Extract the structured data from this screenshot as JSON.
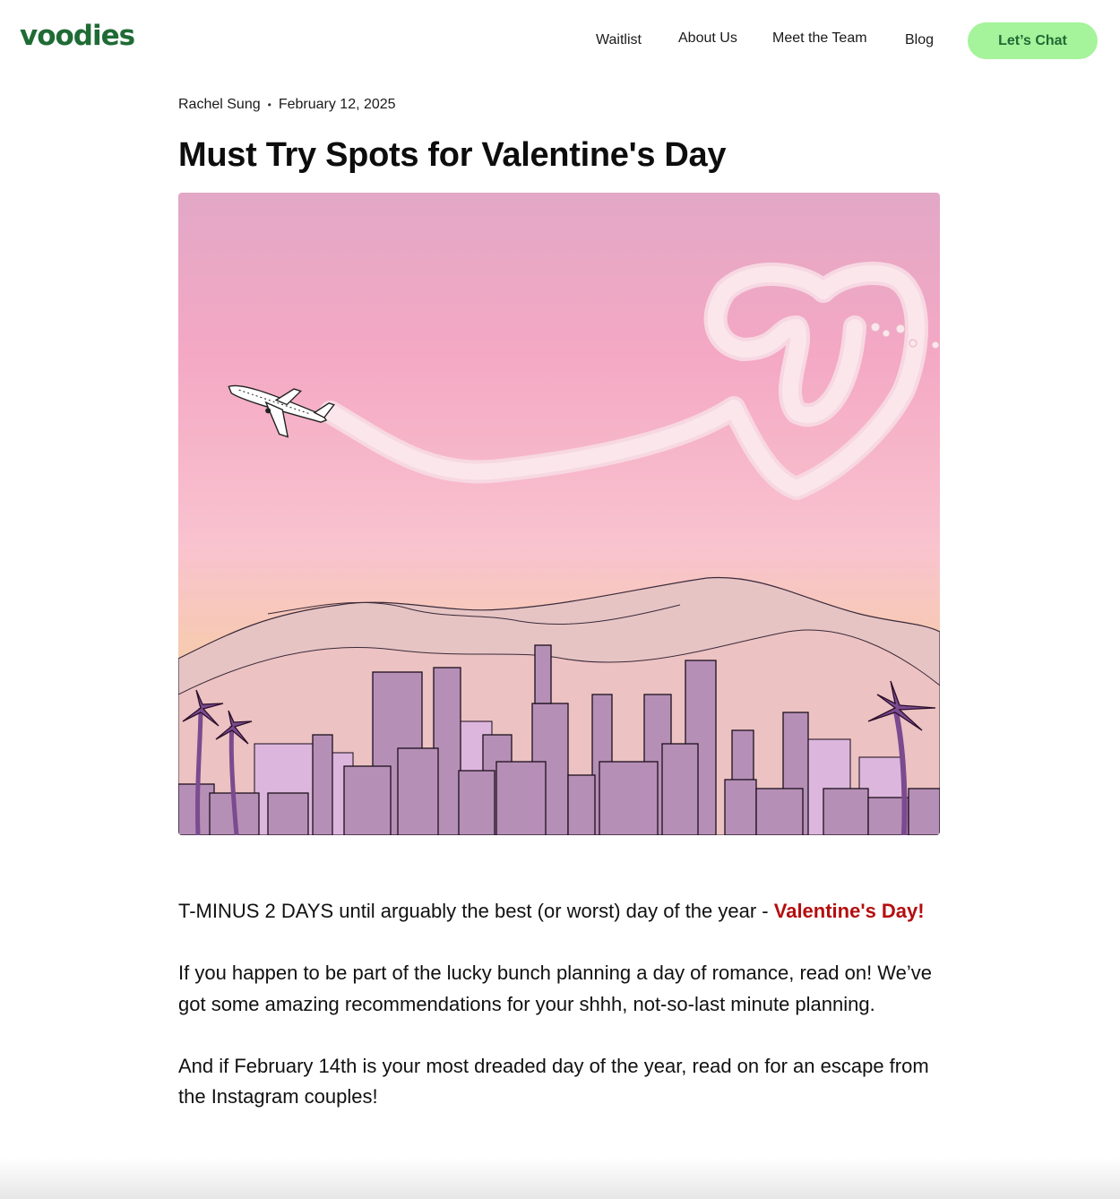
{
  "brand": {
    "logo_text": "voodies",
    "color": "#1f6b35"
  },
  "nav": {
    "waitlist": "Waitlist",
    "about": "About Us",
    "team": "Meet the Team",
    "blog": "Blog",
    "cta": "Let’s Chat",
    "cta_color": "#a5f39a"
  },
  "post": {
    "author": "Rachel Sung",
    "separator": "•",
    "date": "February 12, 2025",
    "title": "Must Try Spots for Valentine's Day",
    "hero_image": "illustration-airplane-skywriting-heart-over-city-skyline",
    "p1_text": "T-MINUS 2 DAYS until arguably the best (or worst) day of the year - ",
    "p1_highlight": "Valentine's Day!",
    "highlight_color": "#b50d0d",
    "p2": "If you happen to be part of the lucky bunch planning a day of romance, read on! We’ve got some amazing recommendations for your shhh, not-so-last minute planning.",
    "p3": "And if February 14th is your most dreaded day of the year, read on for an escape from the Instagram couples!"
  }
}
